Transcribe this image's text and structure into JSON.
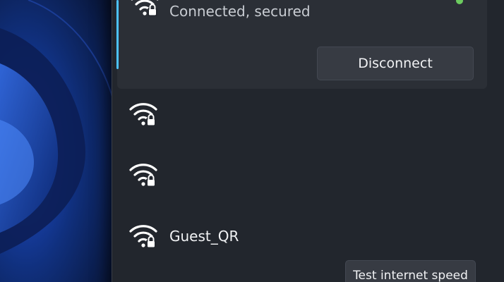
{
  "connected_network": {
    "status": "Connected, secured",
    "icon": "wifi-lock-icon",
    "disconnect_label": "Disconnect"
  },
  "networks": [
    {
      "name": "",
      "icon": "wifi-lock-icon"
    },
    {
      "name": "",
      "icon": "wifi-lock-icon"
    },
    {
      "name": "Guest_QR",
      "icon": "wifi-lock-icon"
    }
  ],
  "footer": {
    "test_speed_label": "Test internet speed"
  },
  "colors": {
    "accent": "#4cc2ff",
    "connected_indicator": "#6ccb5f",
    "panel_bg": "#22262d"
  }
}
